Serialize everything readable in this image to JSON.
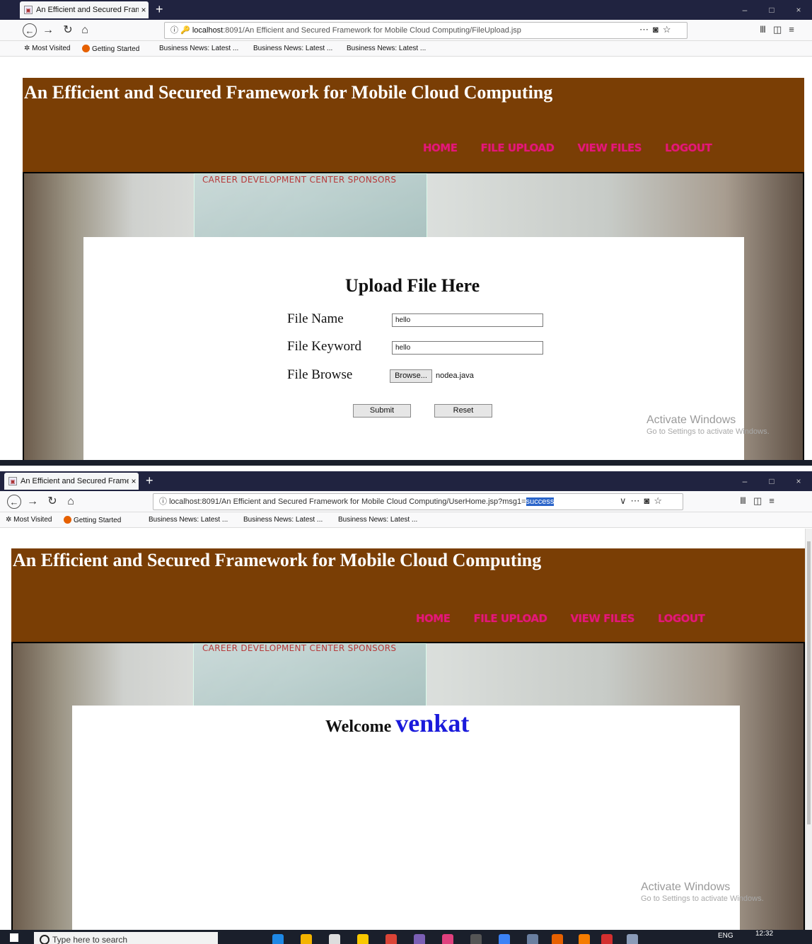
{
  "screens": {
    "upload": {
      "tab_title": "An Efficient and Secured Frame",
      "tab_close": "×",
      "new_tab": "+",
      "url_host": "localhost",
      "url_rest": ":8091/An Efficient and Secured Framework for Mobile Cloud Computing/FileUpload.jsp",
      "site_title": "An Efficient and Secured Framework for Mobile Cloud Computing",
      "menu": [
        "HOME",
        "FILE UPLOAD",
        "VIEW FILES",
        "LOGOUT"
      ],
      "sponsor_text": "CAREER DEVELOPMENT CENTER SPONSORS",
      "form": {
        "heading": "Upload File Here",
        "file_name_label": "File Name",
        "file_name_value": "hello",
        "keyword_label": "File Keyword",
        "keyword_value": "hello",
        "browse_label": "File Browse",
        "browse_button": "Browse...",
        "selected_file": "nodea.java",
        "submit": "Submit",
        "reset": "Reset"
      },
      "activate": {
        "title": "Activate Windows",
        "sub": "Go to Settings to activate Windows."
      }
    },
    "home": {
      "tab_title": "An Efficient and Secured Frame",
      "tab_close": "×",
      "new_tab": "+",
      "url_prefix": "localhost:8091/An Efficient and Secured Framework for Mobile Cloud Computing/UserHome.jsp?msg1=",
      "url_selected": "success",
      "site_title": "An Efficient and Secured Framework for Mobile Cloud Computing",
      "menu": [
        "HOME",
        "FILE UPLOAD",
        "VIEW FILES",
        "LOGOUT"
      ],
      "sponsor_text": "CAREER DEVELOPMENT CENTER SPONSORS",
      "welcome_word": "Welcome",
      "username": "venkat",
      "activate": {
        "title": "Activate Windows",
        "sub": "Go to Settings to activate Windows."
      },
      "taskbar": {
        "search_placeholder": "Type here to search",
        "lang": "ENG",
        "time": "12:32"
      }
    }
  },
  "bookmarks": [
    "Most Visited",
    "Getting Started",
    "Business News: Latest ...",
    "Business News: Latest ...",
    "Business News: Latest ..."
  ],
  "window_controls": [
    "–",
    "□",
    "×"
  ],
  "colors": {
    "header_brown": "#7a3e05",
    "menu_pink": "#e5177a",
    "username_blue": "#1a1adb",
    "tabbar": "#202340"
  }
}
